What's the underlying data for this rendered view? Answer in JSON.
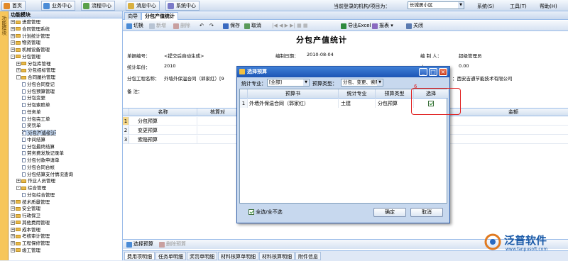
{
  "topbar": {
    "tabs": [
      "首页",
      "业务中心",
      "流程中心",
      "消息中心",
      "系统中心"
    ],
    "org_label": "当前登录的机构/项目为：",
    "org_value": "长城居小区",
    "links": [
      "系统(S)",
      "工具(T)",
      "帮助(H)"
    ]
  },
  "sidebar": {
    "vertical_label": "功能模块",
    "header": "功能模块",
    "items": [
      {
        "label": "进度管理",
        "level": 1,
        "exp": "+"
      },
      {
        "label": "合同管理系统",
        "level": 1,
        "exp": "+"
      },
      {
        "label": "计划统计管理",
        "level": 1,
        "exp": "+"
      },
      {
        "label": "物资管理",
        "level": 1,
        "exp": "+"
      },
      {
        "label": "机械设备管理",
        "level": 1,
        "exp": "+"
      },
      {
        "label": "分包管理",
        "level": 1,
        "exp": "-"
      },
      {
        "label": "分包库管理",
        "level": 2,
        "exp": "+"
      },
      {
        "label": "分包招标管理",
        "level": 2,
        "exp": "+"
      },
      {
        "label": "合同履约管理",
        "level": 2,
        "exp": "-"
      },
      {
        "label": "分包合同登记",
        "level": 3
      },
      {
        "label": "分包预算管理",
        "level": 3
      },
      {
        "label": "分包变更",
        "level": 3
      },
      {
        "label": "分包索赔单",
        "level": 3
      },
      {
        "label": "任务单",
        "level": 3
      },
      {
        "label": "分包完工单",
        "level": 3
      },
      {
        "label": "奖罚单",
        "level": 3
      },
      {
        "label": "分包产值统计",
        "level": 3,
        "selected": true
      },
      {
        "label": "中间结算",
        "level": 3
      },
      {
        "label": "分包最终结算",
        "level": 3
      },
      {
        "label": "劳务费发放记录单",
        "level": 3
      },
      {
        "label": "分包付款申请单",
        "level": 3
      },
      {
        "label": "分包合同台帐",
        "level": 3
      },
      {
        "label": "分包结算支付情况查询",
        "level": 3
      },
      {
        "label": "作业人员管理",
        "level": 2,
        "exp": "+"
      },
      {
        "label": "综合管理",
        "level": 2,
        "exp": "-"
      },
      {
        "label": "分包综合管理",
        "level": 3
      },
      {
        "label": "技术质量管理",
        "level": 1,
        "exp": "+"
      },
      {
        "label": "安全管理",
        "level": 1,
        "exp": "+"
      },
      {
        "label": "行政保卫",
        "level": 1,
        "exp": "+"
      },
      {
        "label": "其他费用管理",
        "level": 1,
        "exp": "+"
      },
      {
        "label": "成本管理",
        "level": 1,
        "exp": "+"
      },
      {
        "label": "考核审计管理",
        "level": 1,
        "exp": "+"
      },
      {
        "label": "工程保修管理",
        "level": 1,
        "exp": "+"
      },
      {
        "label": "竣工管理",
        "level": 1,
        "exp": "+"
      }
    ]
  },
  "tabs": [
    "向导",
    "分包产值统计"
  ],
  "toolbar": {
    "switch": "切换",
    "add": "新增",
    "delete": "删除",
    "save": "保存",
    "cancel": "取消",
    "export": "导出Excel",
    "report": "报表",
    "close": "关闭"
  },
  "form": {
    "title": "分包产值统计",
    "doc_no_label": "单据编号：",
    "doc_no_value": "<提交后自动生成>",
    "date_label": "编制日期：",
    "date_value": "2010-08-04",
    "creator_label": "编 制 人：",
    "creator_value": "超级管理员",
    "year_label": "统计年份：",
    "year_value": "2010",
    "amount_label": "本",
    "amount_value": "0.00",
    "project_label": "分包工程名称：",
    "project_value": "外墙外保温合同（郭家红）[9",
    "company_value": "：西安吉通节能技术有限公司",
    "remark_label": "备  注："
  },
  "grid": {
    "headers": [
      "名称",
      "核算对",
      "金额"
    ],
    "rows": [
      {
        "no": "1",
        "name": "分包预算"
      },
      {
        "no": "2",
        "name": "变更预算"
      },
      {
        "no": "3",
        "name": "索赔预算"
      }
    ],
    "select_button": "选择预算",
    "delete_button": "删除预算"
  },
  "bottom_tabs": [
    "费用项明细",
    "任务单明细",
    "奖罚单明细",
    "材料核算单明细",
    "材料核算明细",
    "附件信息"
  ],
  "dialog": {
    "title": "选择预算",
    "filter_label": "统计专业：",
    "filter_value": "[全部]",
    "type_label": "预算类型：",
    "type_value": "分包、变更、索赔",
    "headers": [
      "预算书",
      "统计专业",
      "预算类型",
      "选择"
    ],
    "row": {
      "no": "1",
      "book": "外墙外保温合同（郭家红）",
      "major": "土建",
      "type": "分包预算"
    },
    "select_all": "全选/全不选",
    "ok": "确定",
    "cancel": "取消",
    "step": "6"
  },
  "logo": {
    "text": "泛普软件",
    "url": "www.fanpusoft.com"
  }
}
